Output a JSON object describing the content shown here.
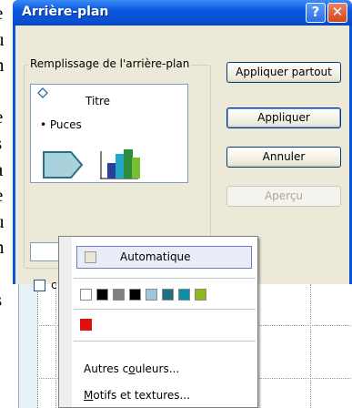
{
  "background": {
    "left_letters": [
      "e",
      "u",
      "n",
      "t",
      "e",
      "s",
      "a",
      "e",
      "u",
      "n",
      "t",
      "s"
    ],
    "right_letters": [
      "e",
      "d",
      "u",
      "e",
      "l",
      "a"
    ]
  },
  "dialog": {
    "title": "Arrière-plan",
    "help_button": "?",
    "close_button": "✕",
    "group_label": "Remplissage de l'arrière-plan",
    "preview": {
      "title_text": "Titre",
      "bullet_text": "Puces"
    },
    "buttons": {
      "apply_all": "Appliquer partout",
      "apply": "Appliquer",
      "cancel": "Annuler",
      "preview": "Aperçu"
    },
    "checkbox_label_visible": "c"
  },
  "color_popup": {
    "automatic_label": "Automatique",
    "swatches": [
      "#ffffff",
      "#000000",
      "#808080",
      "#000000",
      "#9cc8d8",
      "#1e6f86",
      "#0e8fa8",
      "#8cb91a"
    ],
    "recent_swatches": [
      "#e01010"
    ],
    "more_colors_prefix": "Autres c",
    "more_colors_key": "o",
    "more_colors_suffix": "uleurs...",
    "fill_effects_key": "M",
    "fill_effects_suffix": "otifs et textures..."
  },
  "colors": {
    "titlebar": "#0a4fd0",
    "dialog_face": "#ece9d8",
    "close_button": "#d2461e"
  }
}
